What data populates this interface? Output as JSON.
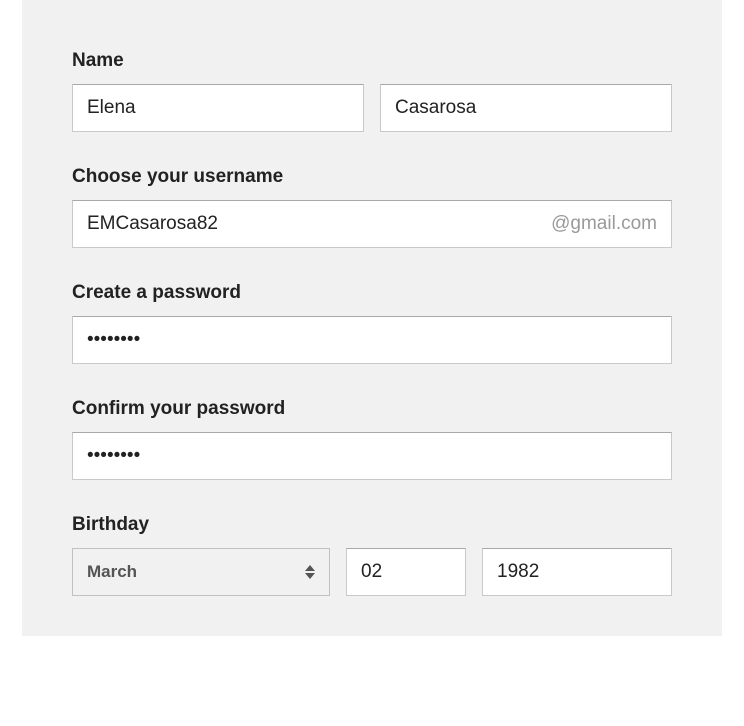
{
  "name": {
    "label": "Name",
    "first": "Elena",
    "last": "Casarosa"
  },
  "username": {
    "label": "Choose your username",
    "value": "EMCasarosa82",
    "suffix": "@gmail.com"
  },
  "password": {
    "label": "Create a password",
    "value": "••••••••"
  },
  "confirm_password": {
    "label": "Confirm your password",
    "value": "••••••••"
  },
  "birthday": {
    "label": "Birthday",
    "month": "March",
    "day": "02",
    "year": "1982"
  }
}
